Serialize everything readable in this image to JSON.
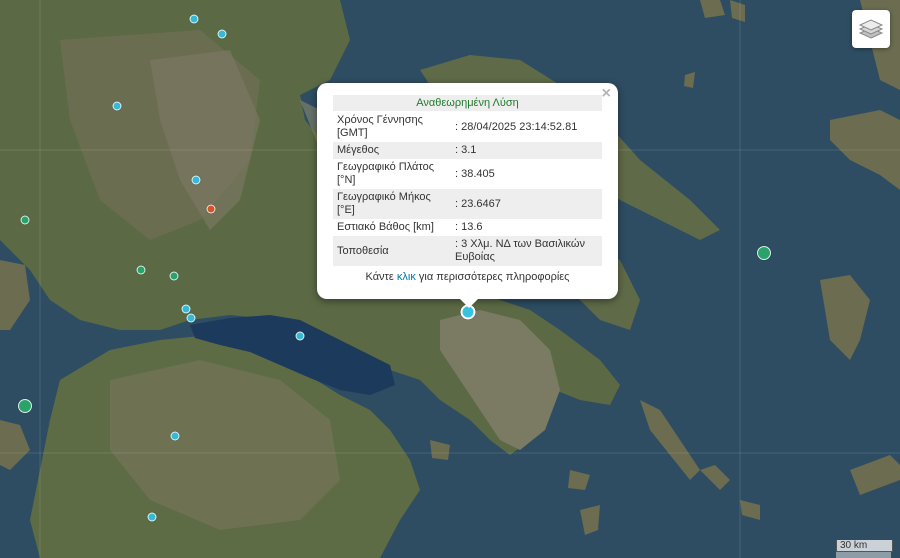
{
  "popup": {
    "title": "Αναθεωρημένη Λύση",
    "close_symbol": "×",
    "rows": [
      {
        "label": "Χρόνος Γέννησης [GMT]",
        "value": ": 28/04/2025 23:14:52.81"
      },
      {
        "label": "Μέγεθος",
        "value": ": 3.1"
      },
      {
        "label": "Γεωγραφικό Πλάτος [°N]",
        "value": ": 38.405"
      },
      {
        "label": "Γεωγραφικό Μήκος [°E]",
        "value": ": 23.6467"
      },
      {
        "label": "Εστιακό Βάθος [km]",
        "value": ": 13.6"
      },
      {
        "label": "Τοποθεσία",
        "value": ": 3 Χλμ. ΝΔ των Βασιλικών Ευβοίας"
      }
    ],
    "more_prefix": "Κάντε ",
    "more_link": "κλικ",
    "more_suffix": " για περισσότερες πληροφορίες"
  },
  "scale": {
    "label": "30 km"
  },
  "layers_control": {
    "icon": "layers-icon"
  },
  "colors": {
    "quake_blue": "#35b9d6",
    "quake_green": "#2aa36b",
    "quake_orange": "#d0562a",
    "title_green": "#207a2c",
    "link_blue": "#0078a8"
  }
}
